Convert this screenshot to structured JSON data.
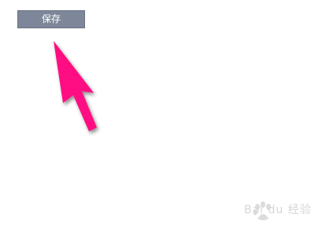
{
  "toolbar": {
    "save_label": "保存"
  },
  "annotation": {
    "arrow_color": "#ff0f82",
    "icon": "pointer-arrow-icon"
  },
  "watermark": {
    "text": "Bai du 经验",
    "color": "#d6d6d6",
    "icon": "paw-icon"
  },
  "colors": {
    "background": "#ffffff",
    "button_bg": "#7d8799",
    "button_text": "#ffffff"
  }
}
